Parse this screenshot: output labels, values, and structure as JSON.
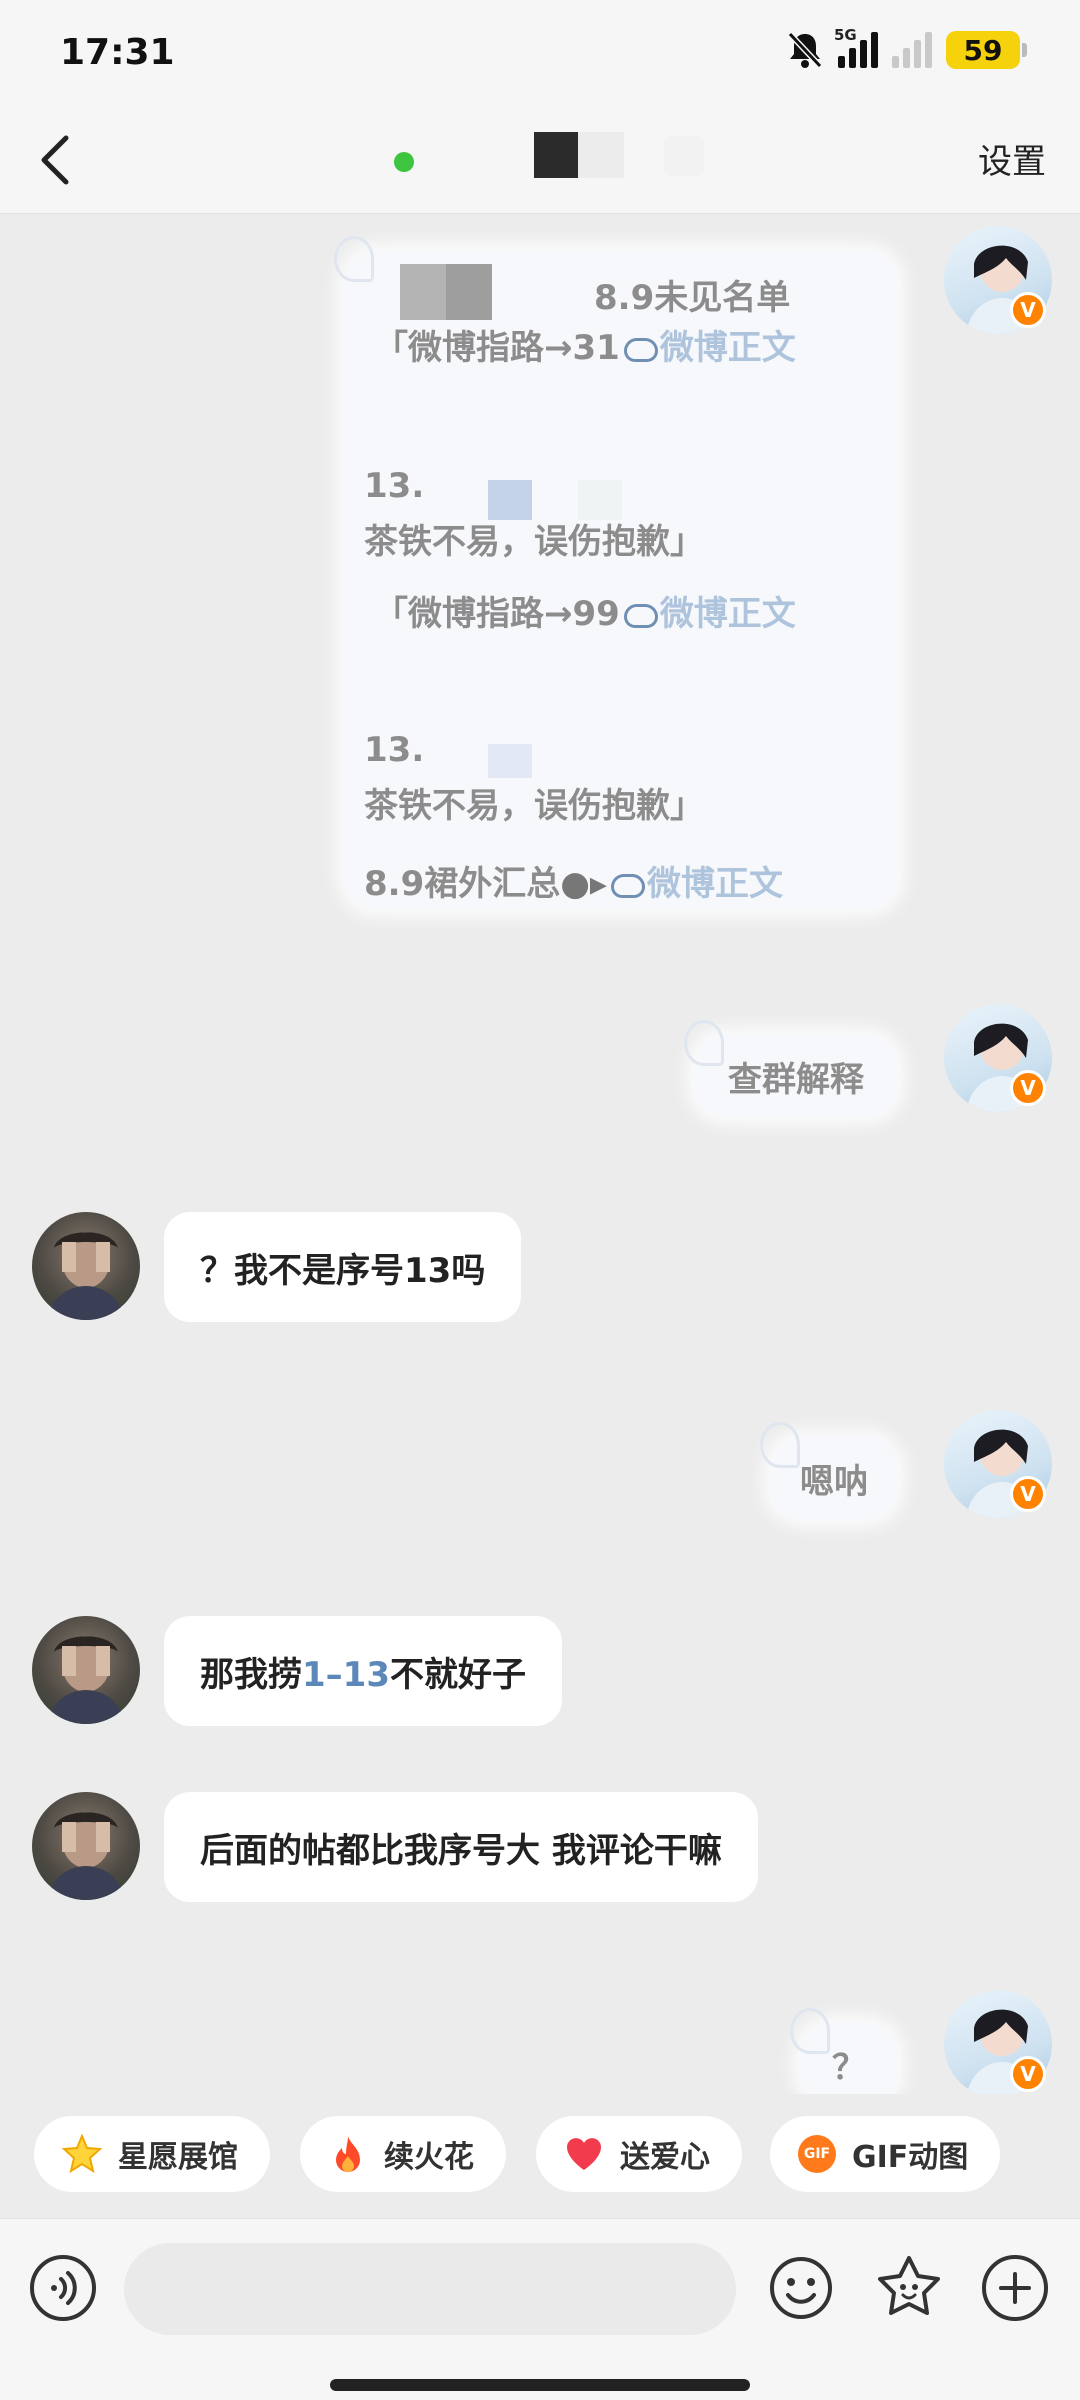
{
  "status_bar": {
    "time": "17:31",
    "network": "5G",
    "battery": "59"
  },
  "nav": {
    "back_icon": "chevron-left-icon",
    "settings_label": "设置"
  },
  "messages": {
    "m1": {
      "title": "8.9未见名单",
      "l1_pre": "「微博指路→31",
      "l1_link": "微博正文",
      "l2_num": "13.",
      "l3": "茶铁不易，误伤抱歉」",
      "l4_pre": "「微博指路→99",
      "l4_link": "微博正文",
      "l5_num": "13.",
      "l6": "茶铁不易，误伤抱歉」",
      "l7_pre": "8.9裙外汇总",
      "l7_link": "微博正文"
    },
    "m2": "查群解释",
    "m3": "？我不是序号13吗",
    "m4": "嗯呐",
    "m5_pre": "那我捞",
    "m5_hl": "1–13",
    "m5_post": "不就好子",
    "m6": "后面的帖都比我序号大  我评论干嘛",
    "m7": "？"
  },
  "verified_badge": "V",
  "chips": [
    {
      "label": "星愿展馆",
      "icon": "star-icon"
    },
    {
      "label": "续火花",
      "icon": "fire-icon"
    },
    {
      "label": "送爱心",
      "icon": "heart-icon"
    },
    {
      "label": "GIF动图",
      "icon": "gif-icon",
      "icon_text": "GIF"
    }
  ],
  "colors": {
    "online": "#3ec43e",
    "vip_badge": "#ff8200",
    "battery": "#f5d20c",
    "link": "#aec3dc"
  }
}
